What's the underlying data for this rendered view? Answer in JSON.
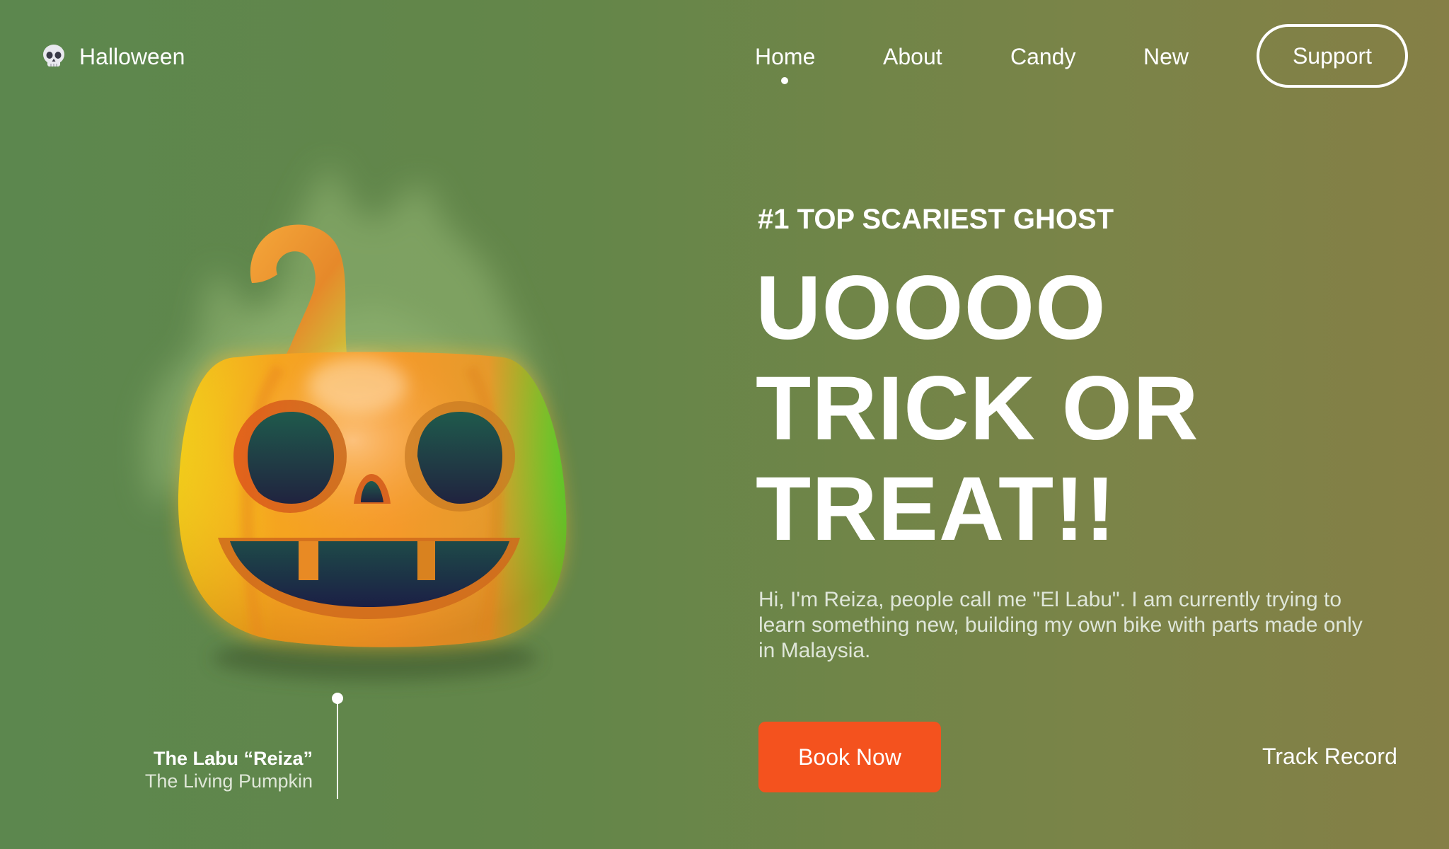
{
  "header": {
    "logo_icon": "skull-icon",
    "brand": "Halloween",
    "nav": [
      {
        "label": "Home",
        "active": true
      },
      {
        "label": "About",
        "active": false
      },
      {
        "label": "Candy",
        "active": false
      },
      {
        "label": "New",
        "active": false
      }
    ],
    "support_label": "Support"
  },
  "hero": {
    "eyebrow": "#1 TOP SCARIEST GHOST",
    "headline": [
      "UOOOO",
      "TRICK OR",
      "TREAT!!"
    ],
    "intro": "Hi, I'm Reiza, people call me \"El Labu\". I am currently trying to learn something new, building my own bike with parts made only in Malaysia.",
    "book_label": "Book Now",
    "track_label": "Track Record"
  },
  "character": {
    "image_icon": "jack-o-lantern-icon",
    "name": "The Labu “Reiza”",
    "subtitle": "The Living Pumpkin"
  },
  "colors": {
    "background_start": "#5c874e",
    "background_end": "#857f46",
    "accent_button": "#f4521e",
    "text": "#ffffff"
  }
}
